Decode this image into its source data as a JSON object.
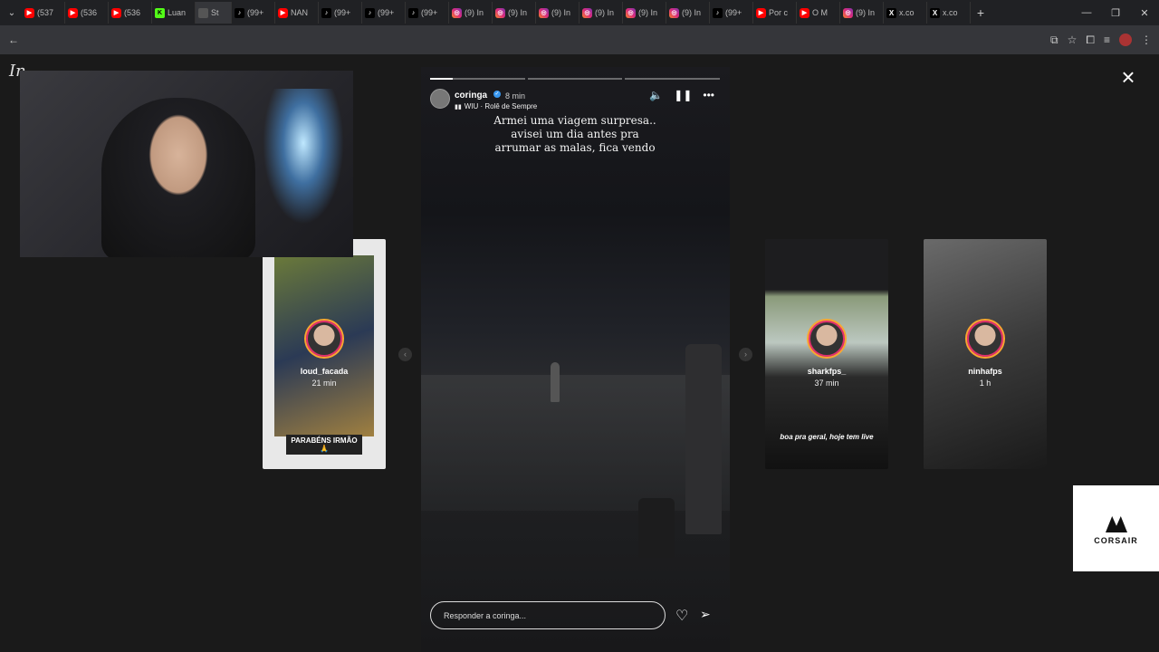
{
  "tabs": [
    {
      "icon": "yt",
      "title": "(537"
    },
    {
      "icon": "yt",
      "title": "(536"
    },
    {
      "icon": "yt",
      "title": "(536"
    },
    {
      "icon": "k",
      "title": "Luan"
    },
    {
      "icon": "st",
      "title": "St",
      "active": true
    },
    {
      "icon": "tt",
      "title": "(99+"
    },
    {
      "icon": "yt",
      "title": "NAN"
    },
    {
      "icon": "tt",
      "title": "(99+"
    },
    {
      "icon": "tt",
      "title": "(99+"
    },
    {
      "icon": "tt",
      "title": "(99+"
    },
    {
      "icon": "ig",
      "title": "(9) In"
    },
    {
      "icon": "ig",
      "title": "(9) In"
    },
    {
      "icon": "ig",
      "title": "(9) In"
    },
    {
      "icon": "ig",
      "title": "(9) In"
    },
    {
      "icon": "ig",
      "title": "(9) In"
    },
    {
      "icon": "ig",
      "title": "(9) In"
    },
    {
      "icon": "tt",
      "title": "(99+"
    },
    {
      "icon": "yt",
      "title": "Por c"
    },
    {
      "icon": "yt",
      "title": "O M"
    },
    {
      "icon": "ig",
      "title": "(9) In"
    },
    {
      "icon": "x",
      "title": "x.co"
    },
    {
      "icon": "x",
      "title": "x.co"
    }
  ],
  "story": {
    "username": "coringa",
    "time": "8 min",
    "music": "WIU · Rolê de Sempre",
    "caption_lines": [
      "Armei uma viagem surpresa..",
      "avisei um dia antes pra",
      "arrumar as malas, fica vendo"
    ],
    "reply_placeholder": "Responder a coringa..."
  },
  "previews": [
    {
      "name": "loud_facada",
      "time": "21 min",
      "caption": "PARABÉNS IRMÃO 🙏"
    },
    {
      "name": "sharkfps_",
      "time": "37 min",
      "caption": "boa pra geral, hoje tem live"
    },
    {
      "name": "ninhafps",
      "time": "1 h",
      "caption": ""
    }
  ],
  "sponsor": {
    "name": "CORSAIR"
  }
}
